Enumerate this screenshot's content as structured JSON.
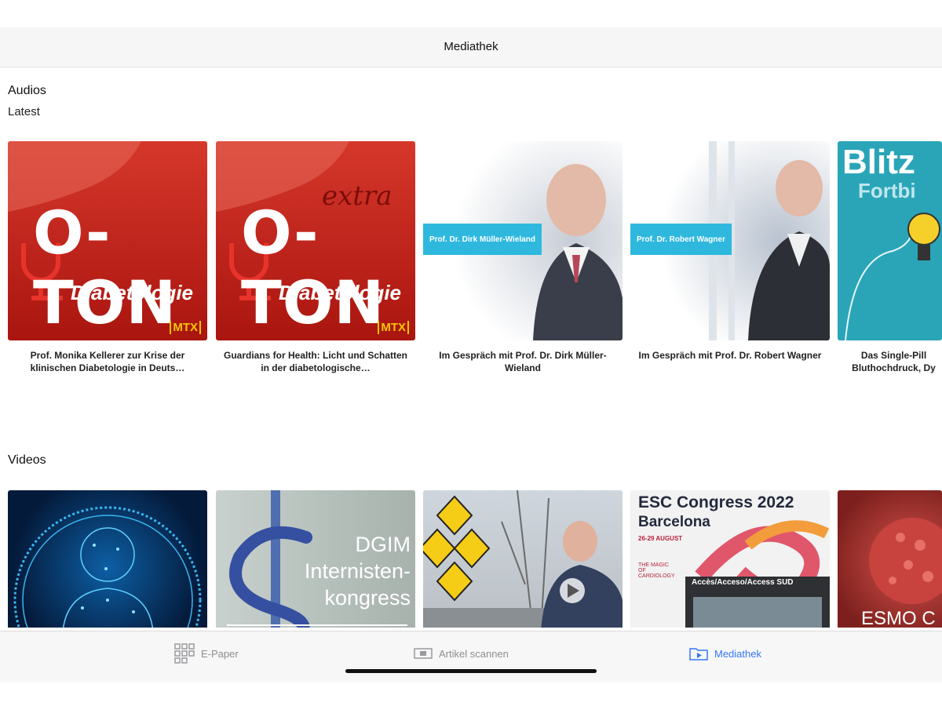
{
  "header": {
    "title": "Mediathek"
  },
  "audios": {
    "section_title": "Audios",
    "subsection_title": "Latest",
    "items": [
      {
        "caption": "Prof. Monika Kellerer zur Krise der klinischen Diabetologie in Deuts…",
        "thumb_title": "O-TON",
        "thumb_subtitle": "Diabetologie",
        "thumb_badge": "MTX"
      },
      {
        "caption": "Guardians for Health: Licht und Schatten in der diabetologische…",
        "thumb_title": "O-TON",
        "thumb_extra": "extra",
        "thumb_subtitle": "Diabetologie",
        "thumb_badge": "MTX"
      },
      {
        "caption": "Im Gespräch mit Prof. Dr. Dirk Müller-Wieland",
        "thumb_name_badge": "Prof. Dr. Dirk Müller-Wieland"
      },
      {
        "caption": "Im Gespräch mit Prof. Dr. Robert Wagner",
        "thumb_name_badge": "Prof. Dr. Robert Wagner"
      },
      {
        "caption": "Das Single-Pill Bluthochdruck, Dy",
        "thumb_title": "Blitz",
        "thumb_subtitle": "Fortbi"
      }
    ]
  },
  "videos": {
    "section_title": "Videos",
    "items": [
      {
        "thumb_text": ""
      },
      {
        "thumb_text": "DGIM Internisten-kongress"
      },
      {
        "thumb_text": ""
      },
      {
        "thumb_title": "ESC Congress 2022",
        "thumb_subtitle": "Barcelona",
        "thumb_date": "26-29 AUGUST",
        "thumb_tagline": "THE MAGIC OF CARDIOLOGY",
        "thumb_sign": "Accès/Acceso/Access SUD"
      },
      {
        "thumb_text": "ESMO C"
      }
    ]
  },
  "tabbar": {
    "tabs": [
      {
        "label": "E-Paper",
        "icon": "grid-icon",
        "active": false
      },
      {
        "label": "Artikel scannen",
        "icon": "scan-icon",
        "active": false
      },
      {
        "label": "Mediathek",
        "icon": "play-folder-icon",
        "active": true
      }
    ]
  },
  "colors": {
    "accent": "#3478f6",
    "oton_red": "#c8261d",
    "badge_blue": "#2eb8de"
  }
}
